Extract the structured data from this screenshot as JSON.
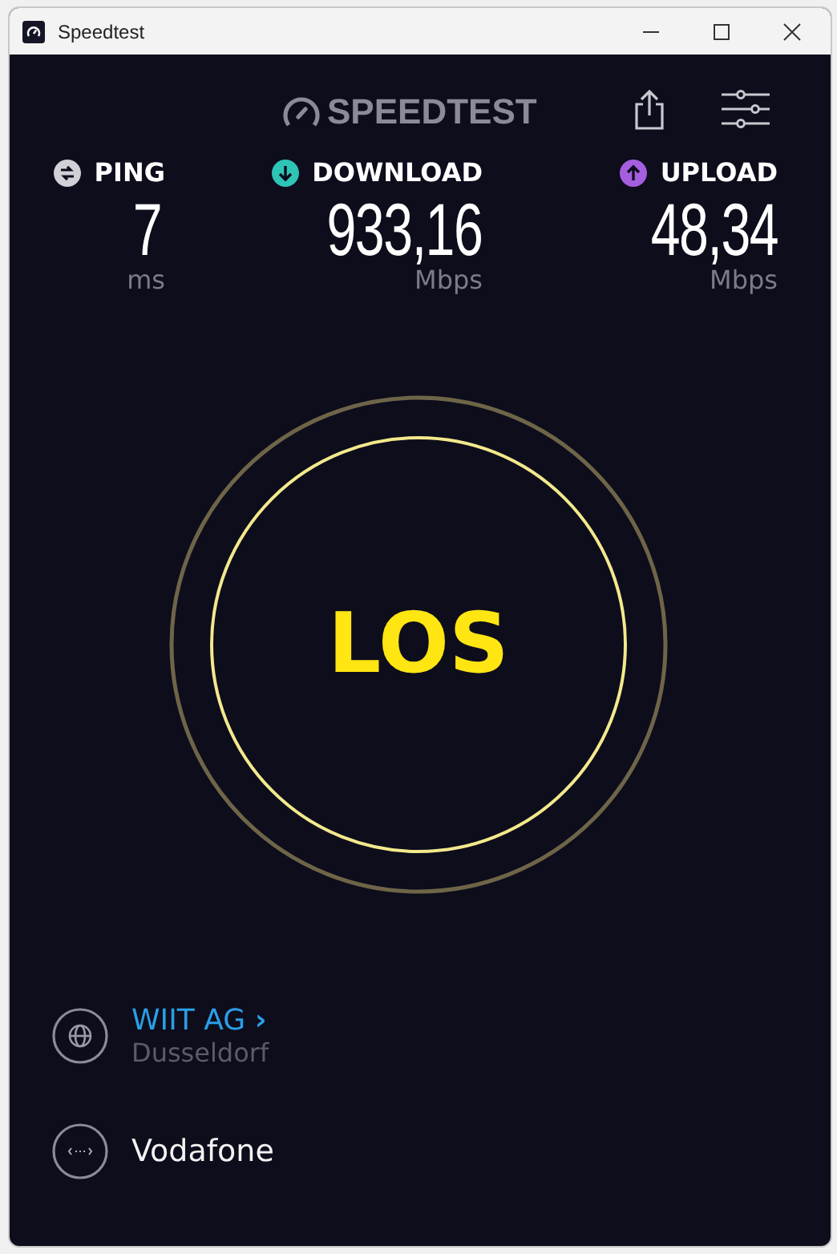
{
  "window": {
    "title": "Speedtest"
  },
  "header": {
    "logo": "SPEEDTEST"
  },
  "metrics": [
    {
      "kind": "ping",
      "label": "PING",
      "value": "7",
      "unit": "ms"
    },
    {
      "kind": "download",
      "label": "DOWNLOAD",
      "value": "933,16",
      "unit": "Mbps"
    },
    {
      "kind": "upload",
      "label": "UPLOAD",
      "value": "48,34",
      "unit": "Mbps"
    }
  ],
  "go_button": {
    "label": "LOS"
  },
  "server": {
    "name": "WIIT AG",
    "chevron": "›",
    "location": "Dusseldorf"
  },
  "provider": {
    "name": "Vodafone"
  }
}
